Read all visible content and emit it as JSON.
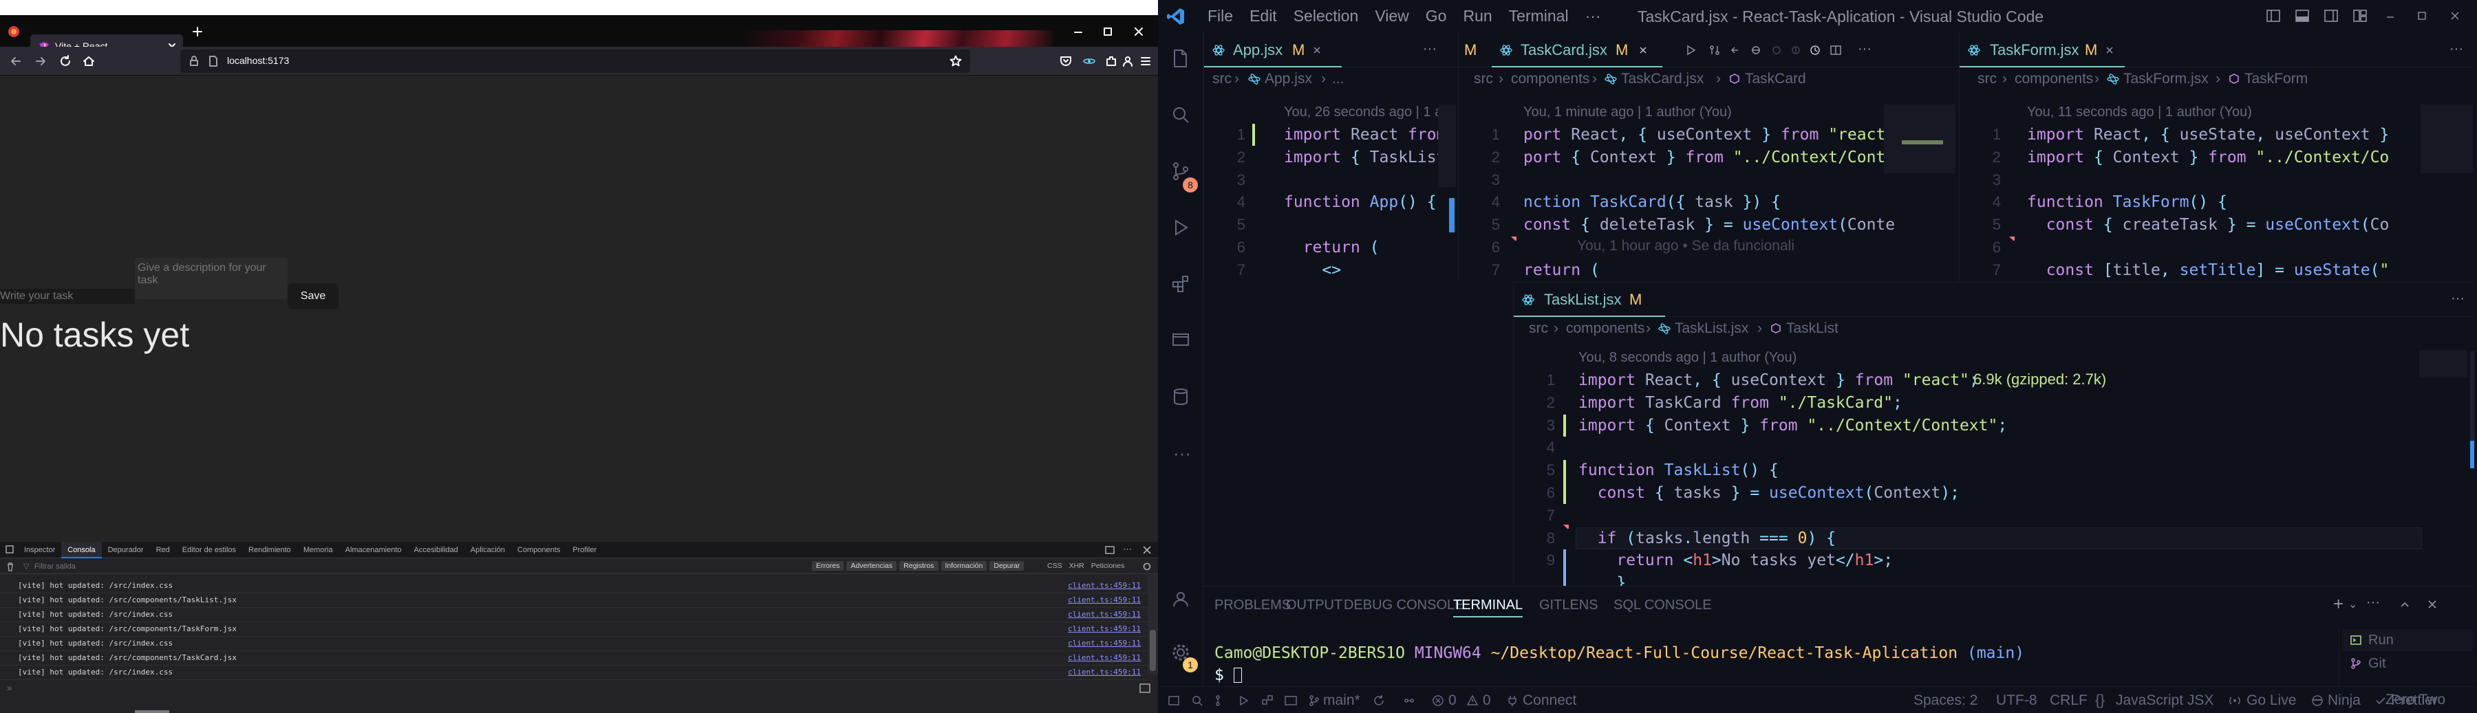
{
  "browser": {
    "tab_title": "Vite + React",
    "url": "localhost:5173",
    "page": {
      "description_placeholder": "Give a description for your task",
      "title_placeholder": "Write your task",
      "save_label": "Save",
      "empty_message": "No tasks yet"
    },
    "devtools": {
      "tabs": [
        "Inspector",
        "Consola",
        "Depurador",
        "Red",
        "Editor de estilos",
        "Rendimiento",
        "Memoria",
        "Almacenamiento",
        "Accesibilidad",
        "Aplicación",
        "Components",
        "Profiler"
      ],
      "filter_placeholder": "Filtrar salida",
      "levels": [
        "Errores",
        "Advertencias",
        "Registros",
        "Información",
        "Depurar"
      ],
      "types": [
        "CSS",
        "XHR",
        "Peticiones"
      ],
      "logs": [
        {
          "text": "[vite] hot updated: /src/index.css",
          "source": "client.ts:459:11"
        },
        {
          "text": "[vite] hot updated: /src/components/TaskList.jsx",
          "source": "client.ts:459:11"
        },
        {
          "text": "[vite] hot updated: /src/index.css",
          "source": "client.ts:459:11"
        },
        {
          "text": "[vite] hot updated: /src/components/TaskForm.jsx",
          "source": "client.ts:459:11"
        },
        {
          "text": "[vite] hot updated: /src/index.css",
          "source": "client.ts:459:11"
        },
        {
          "text": "[vite] hot updated: /src/components/TaskCard.jsx",
          "source": "client.ts:459:11"
        },
        {
          "text": "[vite] hot updated: /src/index.css",
          "source": "client.ts:459:11"
        }
      ]
    }
  },
  "vscode": {
    "menu": [
      "File",
      "Edit",
      "Selection",
      "View",
      "Go",
      "Run",
      "Terminal",
      "···"
    ],
    "window_title": "TaskCard.jsx - React-Task-Aplication - Visual Studio Code",
    "source_control_badge": "8",
    "settings_badge": "1",
    "editors": {
      "app": {
        "tab": "App.jsx",
        "tab_badge": "M",
        "crumbs": [
          "src",
          "App.jsx",
          "..."
        ],
        "blame": "You, 26 seconds ago | 1 author (You)"
      },
      "taskcard": {
        "prev_tab_badge": "M",
        "tab": "TaskCard.jsx",
        "tab_badge": "M",
        "crumbs": [
          "src",
          "components",
          "TaskCard.jsx",
          "TaskCard"
        ],
        "blame": "You, 1 minute ago | 1 author (You)",
        "inline_blame": "You, 1 hour ago • Se da funcionali"
      },
      "taskform": {
        "tab": "TaskForm.jsx",
        "tab_badge": "M",
        "crumbs": [
          "src",
          "components",
          "TaskForm.jsx",
          "TaskForm"
        ],
        "blame": "You, 11 seconds ago | 1 author (You)"
      },
      "tasklist": {
        "tab": "TaskList.jsx",
        "tab_badge": "M",
        "crumbs": [
          "src",
          "components",
          "TaskList.jsx",
          "TaskList"
        ],
        "blame": "You, 8 seconds ago | 1 author (You)",
        "import_cost": "6.9k (gzipped: 2.7k)"
      }
    },
    "panel": {
      "tabs": [
        "PROBLEMS",
        "OUTPUT",
        "DEBUG CONSOLE",
        "TERMINAL",
        "GITLENS",
        "SQL CONSOLE"
      ],
      "prompt_user": "Camo@DESKTOP-2BERS1O",
      "prompt_env": "MINGW64",
      "prompt_path": "~/Desktop/React-Full-Course/React-Task-Aplication",
      "prompt_branch": "(main)",
      "prompt_symbol": "$",
      "terminals": [
        "Run",
        "Git"
      ]
    },
    "status": {
      "branch": "main*",
      "errors": "0",
      "warnings": "0",
      "connect": "Connect",
      "spaces": "Spaces: 2",
      "encoding": "UTF-8",
      "eol": "CRLF",
      "language": "JavaScript JSX",
      "golive": "Go Live",
      "ninja": "Ninja",
      "prettier": "Prettier",
      "theme": "Zero Two"
    }
  }
}
